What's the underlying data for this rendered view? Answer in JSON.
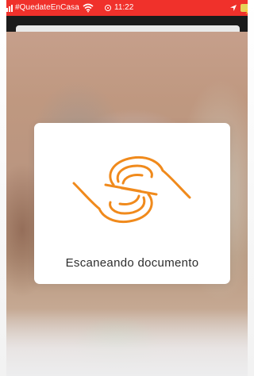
{
  "status_bar": {
    "carrier": "#QuedateEnCasa",
    "time": "11:22",
    "background_color": "#f0312b",
    "icons": [
      "signal-icon",
      "wifi-icon",
      "clock-icon",
      "location-icon",
      "battery-icon"
    ]
  },
  "modal": {
    "message": "Escaneando documento",
    "logo_icon": "scan-hands-logo-icon",
    "accent_color": "#f08a1c"
  }
}
